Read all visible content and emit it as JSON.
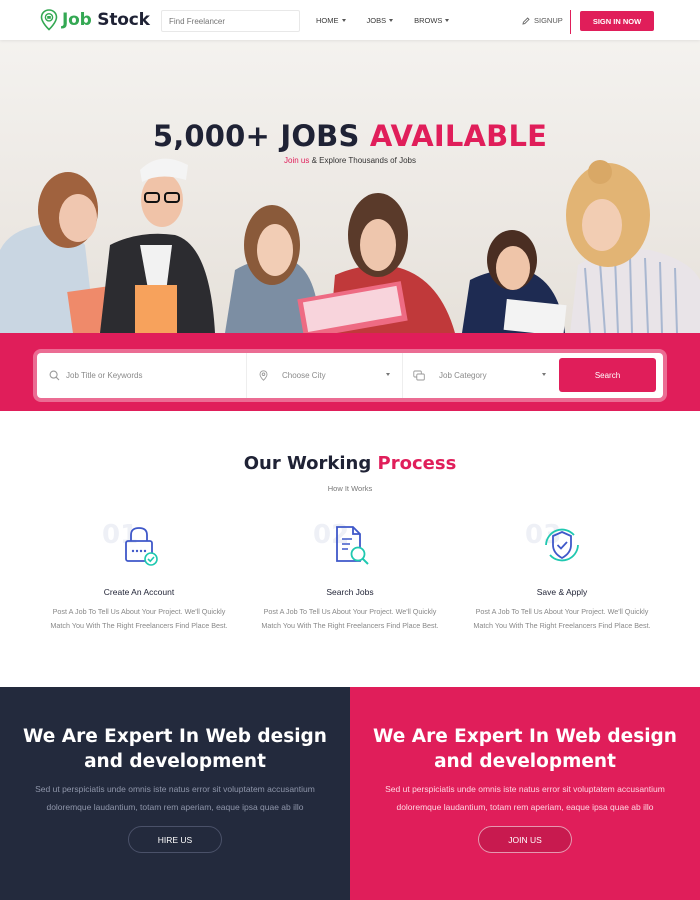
{
  "brand": {
    "name_part1": "Job",
    "name_part2": "Stock",
    "accent_color": "#e01e5a",
    "logo_color": "#34a853"
  },
  "nav": {
    "search_placeholder": "Find Freelancer",
    "items": [
      {
        "label": "HOME"
      },
      {
        "label": "JOBS"
      },
      {
        "label": "BROWS"
      }
    ],
    "signup_label": "SIGNUP",
    "signin_label": "SIGN IN NOW"
  },
  "hero": {
    "title_part1": "5,000+ JOBS",
    "title_part2": "AVAILABLE",
    "subtitle_accent": "Join us",
    "subtitle_rest": "& Explore Thousands of Jobs"
  },
  "search": {
    "keyword_placeholder": "Job Title or Keywords",
    "city_label": "Choose City",
    "category_label": "Job Category",
    "button_label": "Search"
  },
  "process": {
    "title_part1": "Our Working",
    "title_part2": "Process",
    "subtitle": "How It Works",
    "steps": [
      {
        "number": "01",
        "icon": "lock-icon",
        "title": "Create An Account",
        "text": "Post A Job To Tell Us About Your Project. We'll Quickly Match You With The Right Freelancers Find Place Best."
      },
      {
        "number": "02",
        "icon": "document-search-icon",
        "title": "Search Jobs",
        "text": "Post A Job To Tell Us About Your Project. We'll Quickly Match You With The Right Freelancers Find Place Best."
      },
      {
        "number": "03",
        "icon": "shield-check-icon",
        "title": "Save & Apply",
        "text": "Post A Job To Tell Us About Your Project. We'll Quickly Match You With The Right Freelancers Find Place Best."
      }
    ]
  },
  "cta": [
    {
      "title": "We Are Expert In Web design and development",
      "text": "Sed ut perspiciatis unde omnis iste natus error sit voluptatem accusantium doloremque laudantium, totam rem aperiam, eaque ipsa quae ab illo",
      "button": "HIRE US"
    },
    {
      "title": "We Are Expert In Web design and development",
      "text": "Sed ut perspiciatis unde omnis iste natus error sit voluptatem accusantium doloremque laudantium, totam rem aperiam, eaque ipsa quae ab illo",
      "button": "JOIN US"
    }
  ]
}
